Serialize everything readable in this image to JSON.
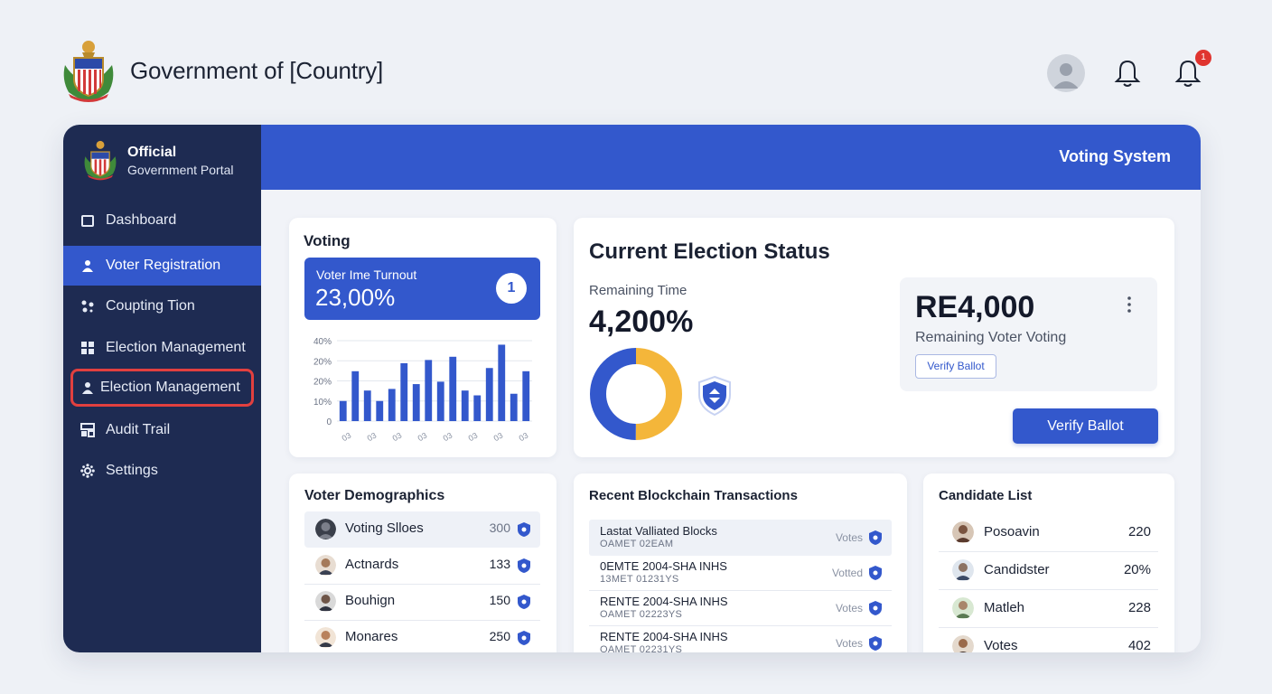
{
  "header": {
    "title": "Government of [Country]",
    "notification_count": "1"
  },
  "sidebar": {
    "brand_line1": "Official",
    "brand_line2": "Government Portal",
    "items": [
      {
        "label": "Dashboard",
        "icon": "dashboard-icon",
        "state": "normal"
      },
      {
        "label": "Voter Registration",
        "icon": "user-icon",
        "state": "active"
      },
      {
        "label": "Coupting Tion",
        "icon": "counting-icon",
        "state": "normal"
      },
      {
        "label": "Election Management",
        "icon": "grid-icon",
        "state": "normal"
      },
      {
        "label": "Election Management",
        "icon": "user-icon",
        "state": "outlined"
      },
      {
        "label": "Audit Trail",
        "icon": "audit-icon",
        "state": "normal"
      },
      {
        "label": "Settings",
        "icon": "gear-icon",
        "state": "normal"
      }
    ]
  },
  "main_header": {
    "title": "Voting System"
  },
  "voting": {
    "title": "Voting",
    "turnout_label": "Voter Ime Turnout",
    "turnout_value": "23,00%",
    "badge": "1",
    "chart_data": {
      "type": "bar",
      "y_ticks": [
        "40%",
        "20%",
        "20%",
        "10%",
        "0"
      ],
      "x_ticks": [
        "03",
        "03",
        "03",
        "03",
        "03",
        "03",
        "03",
        "03"
      ],
      "values": [
        0.25,
        0.62,
        0.38,
        0.25,
        0.4,
        0.72,
        0.46,
        0.76,
        0.49,
        0.8,
        0.38,
        0.32,
        0.66,
        0.95,
        0.34,
        0.62
      ],
      "colors": {
        "bar": "#3358cc",
        "grid": "#e3e7ee"
      }
    }
  },
  "election_status": {
    "title": "Current Election Status",
    "remaining_label": "Remaining Time",
    "remaining_value": "4,200%",
    "donut": {
      "segments": [
        0.5,
        0.5
      ],
      "colors": [
        "#f4b63a",
        "#3358cc"
      ]
    },
    "panel_value": "RE4,000",
    "panel_label": "Remaining Voter Voting",
    "verify_outline_label": "Verify Ballot",
    "verify_primary_label": "Verify Ballot"
  },
  "demographics": {
    "title": "Voter Demographics",
    "rows": [
      {
        "name": "Voting Slloes",
        "value": "300",
        "highlight": true
      },
      {
        "name": "Actnards",
        "value": "133",
        "highlight": false
      },
      {
        "name": "Bouhign",
        "value": "150",
        "highlight": false
      },
      {
        "name": "Monares",
        "value": "250",
        "highlight": false
      }
    ]
  },
  "transactions": {
    "title": "Recent Blockchain Transactions",
    "rows": [
      {
        "main": "Lastat Valliated Blocks",
        "sub": "OAMET 02EAM",
        "status": "Votes",
        "highlight": true
      },
      {
        "main": "0EMTE 2004-SHA INHS",
        "sub": "13MET 01231YS",
        "status": "Votted",
        "highlight": false
      },
      {
        "main": "RENTE 2004-SHA INHS",
        "sub": "OAMET 02223YS",
        "status": "Votes",
        "highlight": false
      },
      {
        "main": "RENTE 2004-SHA INHS",
        "sub": "OAMET 02231YS",
        "status": "Votes",
        "highlight": false
      }
    ]
  },
  "candidates": {
    "title": "Candidate List",
    "rows": [
      {
        "name": "Posoavin",
        "value": "220"
      },
      {
        "name": "Candidster",
        "value": "20%"
      },
      {
        "name": "Matleh",
        "value": "228"
      },
      {
        "name": "Votes",
        "value": "402"
      }
    ]
  },
  "colors": {
    "primary": "#3358cc",
    "sidebar": "#1e2b52",
    "accent": "#f4b63a",
    "alert": "#e2403f"
  }
}
